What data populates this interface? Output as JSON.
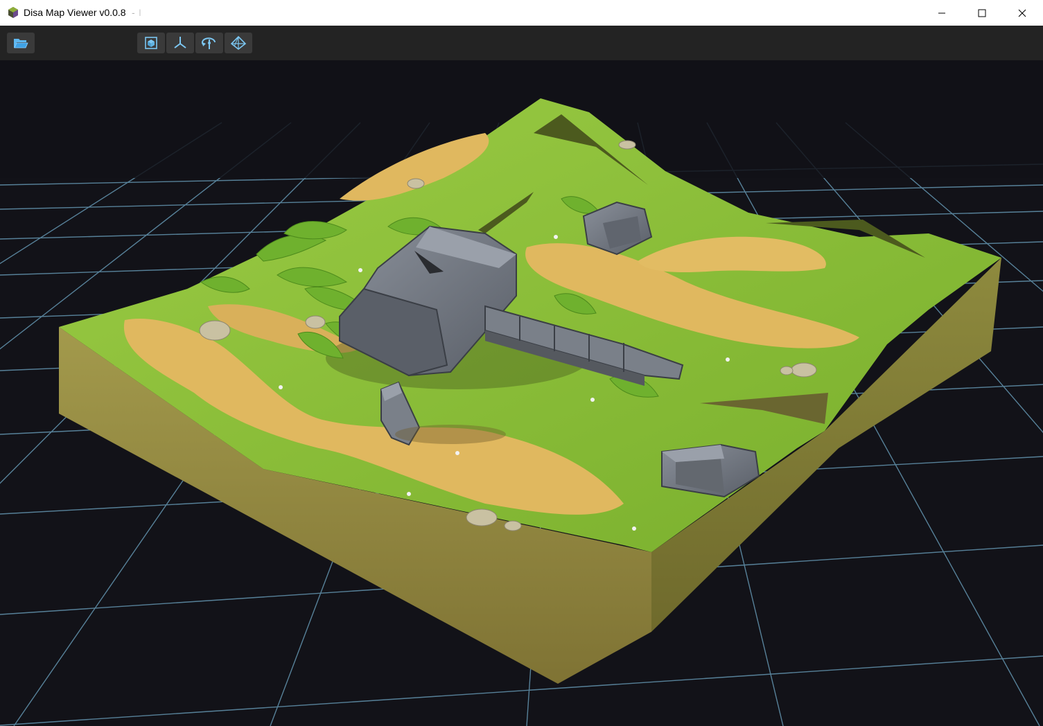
{
  "window": {
    "title": "Disa Map Viewer v0.0.8",
    "title_separator": "-",
    "title_truncated": "I"
  },
  "window_controls": {
    "minimize_icon": "minimize-icon",
    "maximize_icon": "maximize-icon",
    "close_icon": "close-icon"
  },
  "toolbar": {
    "buttons": [
      {
        "icon": "open-folder-icon"
      },
      {
        "icon": "focus-camera-icon"
      },
      {
        "icon": "axes-icon"
      },
      {
        "icon": "orbit-icon"
      },
      {
        "icon": "wireframe-icon"
      }
    ]
  },
  "viewport": {
    "description_colors": {
      "background": "#121218",
      "grid": "#5f8ea8",
      "grass": "#8cbf3a",
      "sand": "#e0b85f",
      "stone": "#6d737d",
      "dirt": "#8f8140"
    }
  }
}
